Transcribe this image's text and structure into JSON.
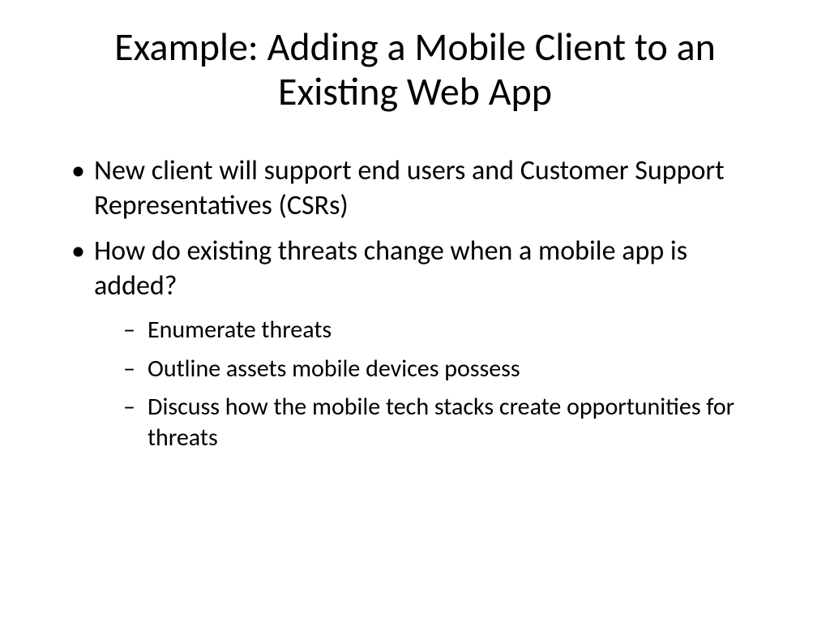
{
  "slide": {
    "title": "Example: Adding a Mobile Client to an Existing Web App",
    "bullets": [
      {
        "text": "New client will support end users and Customer Support Representatives (CSRs)"
      },
      {
        "text": "How do existing threats change when a mobile app is added?",
        "sub": [
          "Enumerate threats",
          "Outline assets mobile devices possess",
          "Discuss how the mobile tech stacks create opportunities for threats"
        ]
      }
    ]
  }
}
